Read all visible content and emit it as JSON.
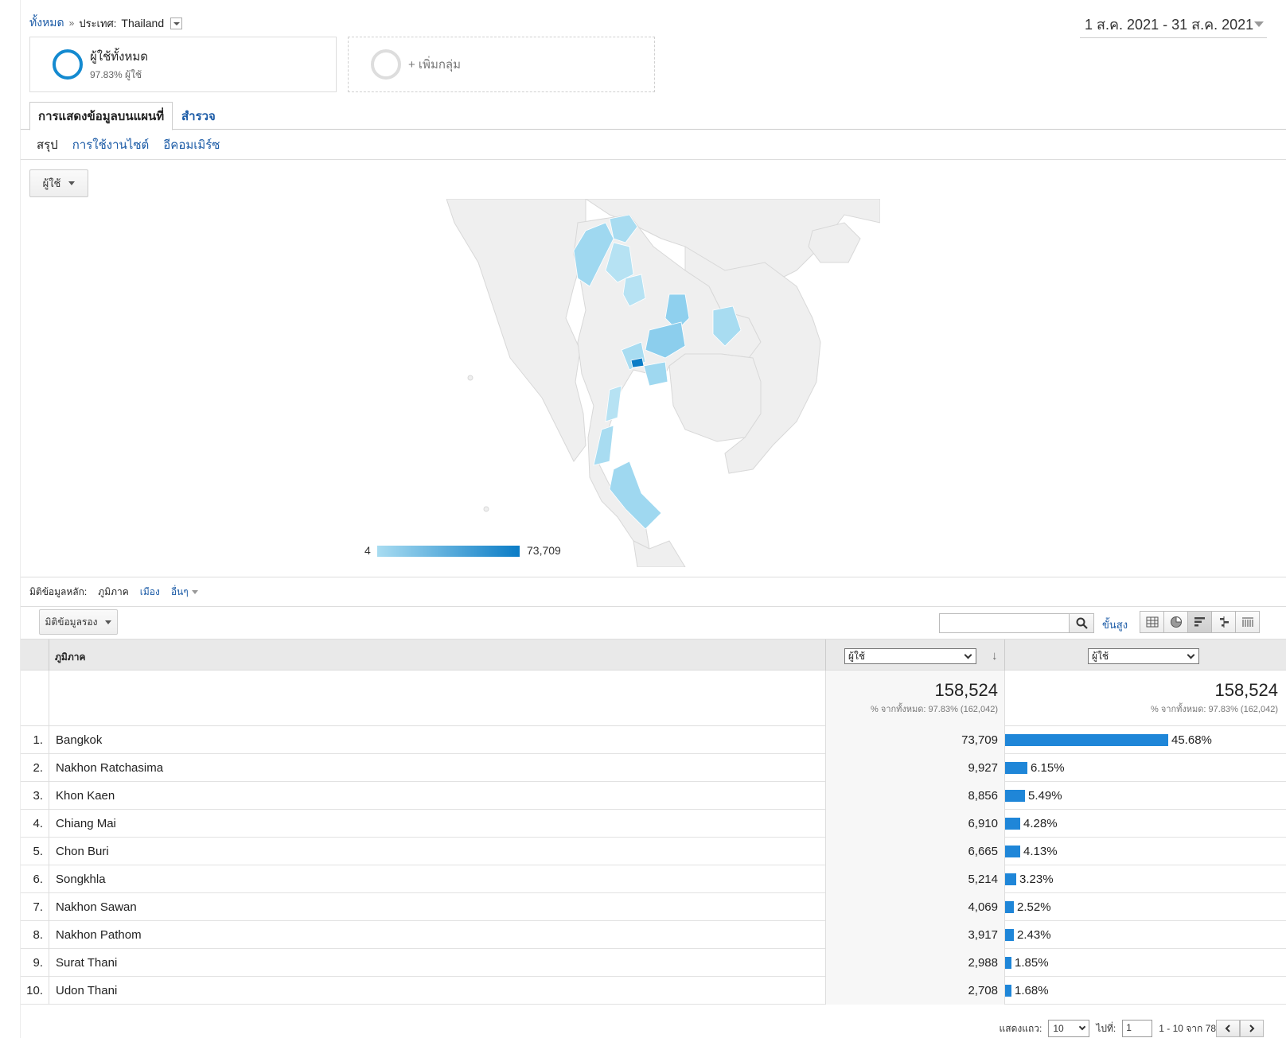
{
  "breadcrumb": {
    "all": "ทั้งหมด",
    "separator": "»",
    "filter_label": "ประเทศ:",
    "filter_value": "Thailand"
  },
  "date_range": "1 ส.ค. 2021 - 31 ส.ค. 2021",
  "segments": {
    "active": {
      "title": "ผู้ใช้ทั้งหมด",
      "subtitle": "97.83% ผู้ใช้"
    },
    "add": {
      "label": "+ เพิ่มกลุ่ม"
    }
  },
  "tabs": {
    "map_overlay": "การแสดงข้อมูลบนแผนที่",
    "explorer": "สำรวจ"
  },
  "subnav": {
    "summary": "สรุป",
    "site_usage": "การใช้งานไซต์",
    "ecommerce": "อีคอมเมิร์ซ"
  },
  "metric_select": "ผู้ใช้",
  "map": {
    "legend_min": "4",
    "legend_max": "73,709",
    "colors": {
      "low": "#a8dcf1",
      "high": "#0b7cc6",
      "base": "#efefef"
    }
  },
  "dimension_bar": {
    "label": "มิติข้อมูลหลัก:",
    "current": "ภูมิภาค",
    "city": "เมือง",
    "other": "อื่นๆ"
  },
  "toolbar": {
    "secondary_dimension": "มิติข้อมูลรอง",
    "advanced": "ขั้นสูง"
  },
  "table": {
    "dimension_header": "ภูมิภาค",
    "metric1_select": "ผู้ใช้",
    "metric2_select": "ผู้ใช้",
    "summary": {
      "total1": "158,524",
      "total1_sub": "% จากทั้งหมด: 97.83% (162,042)",
      "total2": "158,524",
      "total2_sub": "% จากทั้งหมด: 97.83% (162,042)"
    },
    "rows": [
      {
        "num": "1.",
        "region": "Bangkok",
        "users": "73,709",
        "pct": "45.68%",
        "share": 45.68
      },
      {
        "num": "2.",
        "region": "Nakhon Ratchasima",
        "users": "9,927",
        "pct": "6.15%",
        "share": 6.15
      },
      {
        "num": "3.",
        "region": "Khon Kaen",
        "users": "8,856",
        "pct": "5.49%",
        "share": 5.49
      },
      {
        "num": "4.",
        "region": "Chiang Mai",
        "users": "6,910",
        "pct": "4.28%",
        "share": 4.28
      },
      {
        "num": "5.",
        "region": "Chon Buri",
        "users": "6,665",
        "pct": "4.13%",
        "share": 4.13
      },
      {
        "num": "6.",
        "region": "Songkhla",
        "users": "5,214",
        "pct": "3.23%",
        "share": 3.23
      },
      {
        "num": "7.",
        "region": "Nakhon Sawan",
        "users": "4,069",
        "pct": "2.52%",
        "share": 2.52
      },
      {
        "num": "8.",
        "region": "Nakhon Pathom",
        "users": "3,917",
        "pct": "2.43%",
        "share": 2.43
      },
      {
        "num": "9.",
        "region": "Surat Thani",
        "users": "2,988",
        "pct": "1.85%",
        "share": 1.85
      },
      {
        "num": "10.",
        "region": "Udon Thani",
        "users": "2,708",
        "pct": "1.68%",
        "share": 1.68
      }
    ]
  },
  "pager": {
    "rows_label": "แสดงแถว:",
    "rows_value": "10",
    "goto_label": "ไปที่:",
    "goto_value": "1",
    "range": "1 - 10 จาก 78"
  }
}
